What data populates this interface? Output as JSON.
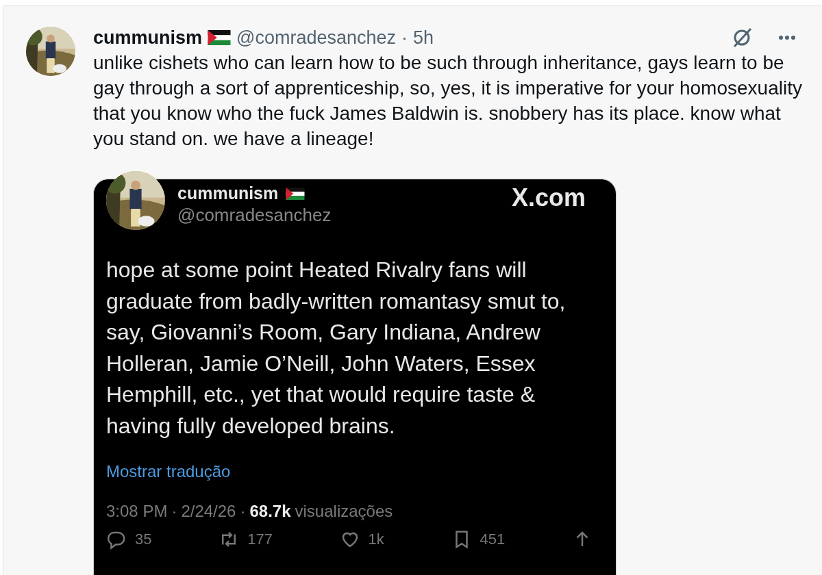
{
  "post": {
    "author": {
      "name": "cummunism",
      "handle": "@comradesanchez",
      "separator": "·",
      "time": "5h"
    },
    "text": "unlike cishets who can learn how to be such through inheritance, gays learn to be gay through a sort of apprenticeship, so, yes, it is imperative for your homosexuality that you know who the fuck James Baldwin is. snobbery has its place. know what you stand on. we have a lineage!",
    "embedded_screenshot": {
      "author": {
        "name": "cummunism",
        "handle": "@comradesanchez"
      },
      "watermark": "X.com",
      "text": "hope at some point Heated Rivalry fans will graduate from badly-written romantasy smut to, say, Giovanni’s Room, Gary Indiana, Andrew Holleran, Jamie O’Neill, John Waters, Essex Hemphill, etc., yet that would require taste & having fully developed brains.",
      "translate_link": "Mostrar tradução",
      "time": "3:08 PM",
      "separators": [
        "·",
        "·"
      ],
      "date": "2/24/26",
      "views": "68.7k",
      "views_label": "visualizações",
      "actions": [
        {
          "kind": "reply",
          "count": "35"
        },
        {
          "kind": "repost",
          "count": "177"
        },
        {
          "kind": "like",
          "count": "1k"
        },
        {
          "kind": "bookmark",
          "count": "451"
        },
        {
          "kind": "share"
        }
      ]
    }
  }
}
